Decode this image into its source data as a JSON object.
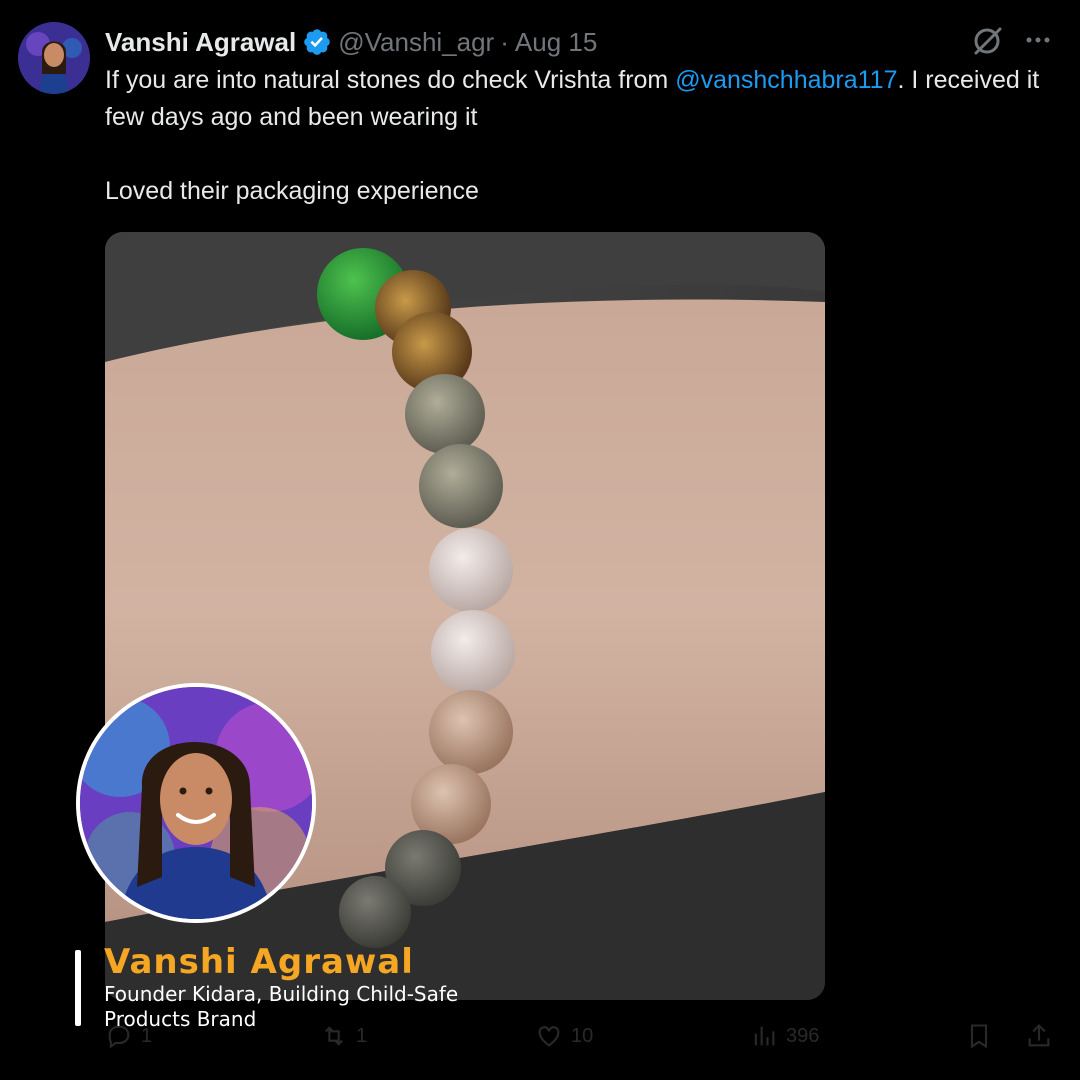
{
  "tweet": {
    "author_name": "Vanshi Agrawal",
    "handle": "@Vanshi_agr",
    "separator": "·",
    "date": "Aug 15",
    "text_line1_before": "If you are into natural stones do check Vrishta from ",
    "mention": "@vanshchhabra117",
    "text_line1_after": ". I received it few days ago and been wearing it",
    "text_line2": "Loved their packaging experience",
    "verified": true,
    "accent_color": "#1d9bf0"
  },
  "actions": {
    "replies": "1",
    "reposts": "1",
    "likes": "10",
    "views": "396"
  },
  "caption": {
    "name": "Vanshi Agrawal",
    "title": "Founder Kidara, Building Child-Safe Products Brand",
    "name_color": "#f5a623"
  },
  "icons": [
    "verified-badge-icon",
    "grok-icon",
    "more-icon",
    "reply-icon",
    "repost-icon",
    "like-icon",
    "views-icon",
    "bookmark-icon",
    "share-icon"
  ]
}
